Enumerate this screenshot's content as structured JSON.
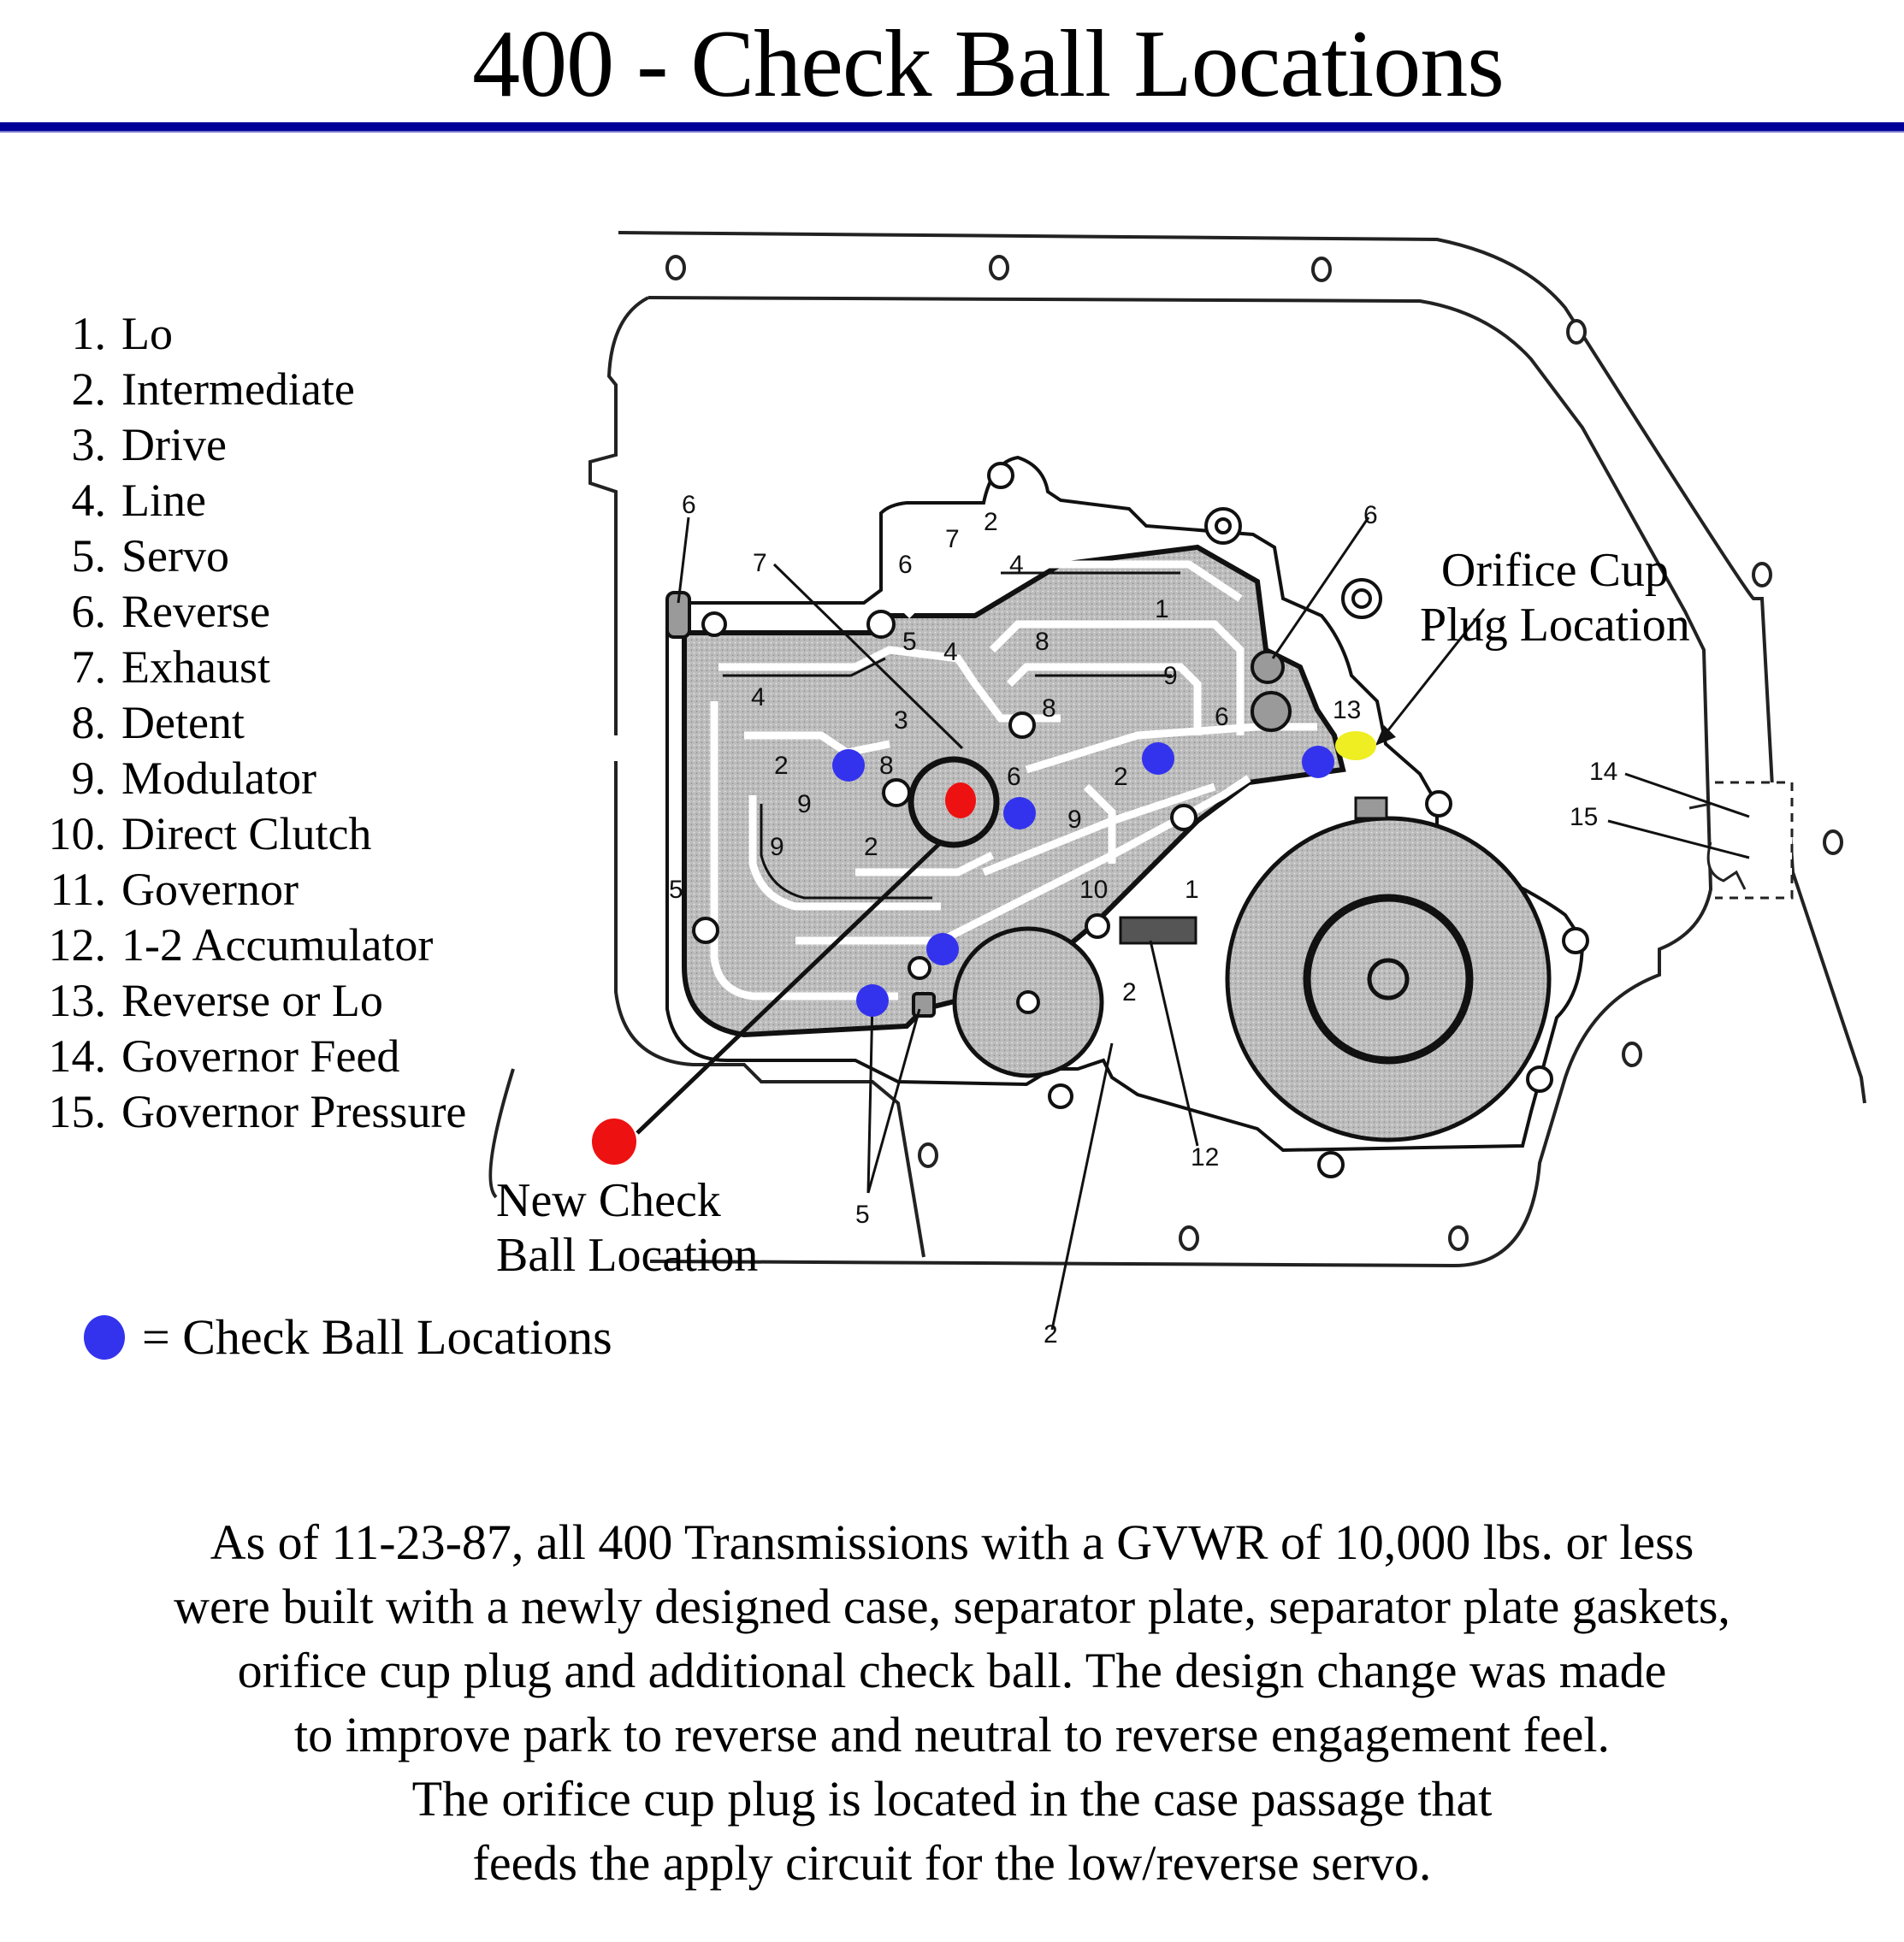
{
  "title": "400 - Check Ball Locations",
  "legend": {
    "items": [
      {
        "num": "1.",
        "label": "Lo"
      },
      {
        "num": "2.",
        "label": "Intermediate"
      },
      {
        "num": "3.",
        "label": "Drive"
      },
      {
        "num": "4.",
        "label": "Line"
      },
      {
        "num": "5.",
        "label": "Servo"
      },
      {
        "num": "6.",
        "label": "Reverse"
      },
      {
        "num": "7.",
        "label": "Exhaust"
      },
      {
        "num": "8.",
        "label": "Detent"
      },
      {
        "num": "9.",
        "label": "Modulator"
      },
      {
        "num": "10.",
        "label": "Direct Clutch"
      },
      {
        "num": "11.",
        "label": "Governor"
      },
      {
        "num": "12.",
        "label": "1-2 Accumulator"
      },
      {
        "num": "13.",
        "label": "Reverse or Lo"
      },
      {
        "num": "14.",
        "label": "Governor Feed"
      },
      {
        "num": "15.",
        "label": "Governor Pressure"
      }
    ]
  },
  "key": {
    "symbol": "blue-dot",
    "label": "= Check Ball Locations"
  },
  "callouts": {
    "new_check_ball": {
      "line1": "New Check",
      "line2": "Ball Location"
    },
    "orifice_cup": {
      "line1": "Orifice Cup",
      "line2": "Plug Location"
    }
  },
  "diagram": {
    "leader_labels": [
      "6",
      "7",
      "6",
      "14",
      "15",
      "5",
      "2",
      "12"
    ],
    "passage_labels": [
      "7",
      "2",
      "6",
      "4",
      "5",
      "4",
      "8",
      "1",
      "9",
      "4",
      "3",
      "8",
      "2",
      "8",
      "9",
      "9",
      "2",
      "6",
      "9",
      "2",
      "6",
      "5",
      "10",
      "1",
      "2",
      "13"
    ],
    "markers": {
      "check_ball_count": 6,
      "new_check_ball_count": 1,
      "orifice_cup_plug_count": 1
    }
  },
  "colors": {
    "rule": "#000099",
    "check_ball": "#3333ee",
    "new_check_ball": "#ee1111",
    "orifice_cup_plug": "#eeee22",
    "passage_fill": "#b8b8b8"
  },
  "note": {
    "lines": [
      "As of 11-23-87, all 400 Transmissions with a GVWR of 10,000 lbs. or less",
      "were built with a newly designed case, separator plate, separator plate gaskets,",
      "orifice cup plug and additional check ball.  The design change was made",
      "to improve park to reverse and neutral to reverse engagement feel.",
      "The orifice cup plug is located in the case passage that",
      "feeds the apply circuit for the low/reverse servo."
    ]
  }
}
